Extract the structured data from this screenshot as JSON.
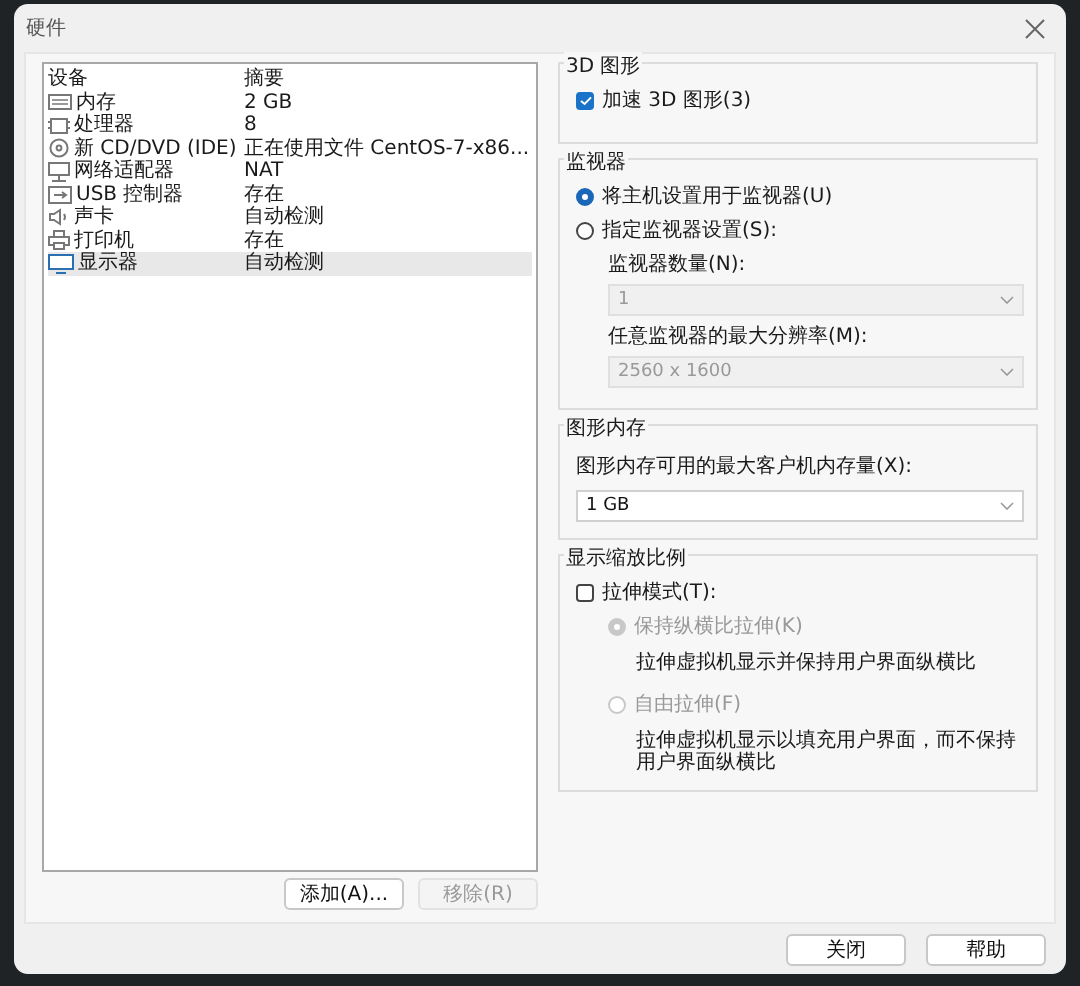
{
  "window": {
    "title": "硬件"
  },
  "devices": {
    "columns": [
      "设备",
      "摘要"
    ],
    "rows": [
      {
        "kind": "memory",
        "name": "内存",
        "summary": "2 GB",
        "selected": false
      },
      {
        "kind": "cpu",
        "name": "处理器",
        "summary": "8",
        "selected": false
      },
      {
        "kind": "disc",
        "name": "新 CD/DVD (IDE)",
        "summary": "正在使用文件 CentOS-7-x86...",
        "selected": false
      },
      {
        "kind": "network",
        "name": "网络适配器",
        "summary": "NAT",
        "selected": false
      },
      {
        "kind": "usb",
        "name": "USB 控制器",
        "summary": "存在",
        "selected": false
      },
      {
        "kind": "sound",
        "name": "声卡",
        "summary": "自动检测",
        "selected": false
      },
      {
        "kind": "printer",
        "name": "打印机",
        "summary": "存在",
        "selected": false
      },
      {
        "kind": "display",
        "name": "显示器",
        "summary": "自动检测",
        "selected": true
      }
    ]
  },
  "device_buttons": [
    {
      "label": "添加(A)...",
      "disabled": false
    },
    {
      "label": "移除(R)",
      "disabled": true
    }
  ],
  "graphics_3d": {
    "title": "3D 图形",
    "accelerate": {
      "label": "加速 3D 图形(3)",
      "checked": true
    }
  },
  "monitors": {
    "title": "监视器",
    "options": [
      {
        "label": "将主机设置用于监视器(U)",
        "selected": true
      },
      {
        "label": "指定监视器设置(S):",
        "selected": false
      }
    ],
    "count": {
      "label": "监视器数量(N):",
      "value": "1",
      "disabled": true
    },
    "resolution": {
      "label": "任意监视器的最大分辨率(M):",
      "value": "2560 x 1600",
      "disabled": true
    }
  },
  "graphics_memory": {
    "title": "图形内存",
    "label": "图形内存可用的最大客户机内存量(X):",
    "value": "1 GB",
    "disabled": false
  },
  "scaling": {
    "title": "显示缩放比例",
    "stretch": {
      "label": "拉伸模式(T):",
      "checked": false
    },
    "options": [
      {
        "label": "保持纵横比拉伸(K)",
        "description": "拉伸虚拟机显示并保持用户界面纵横比",
        "selected": true,
        "disabled": true
      },
      {
        "label": "自由拉伸(F)",
        "description": "拉伸虚拟机显示以填充用户界面，而不保持用户界面纵横比",
        "selected": false,
        "disabled": true
      }
    ]
  },
  "footer_buttons": [
    {
      "label": "关闭"
    },
    {
      "label": "帮助"
    }
  ]
}
